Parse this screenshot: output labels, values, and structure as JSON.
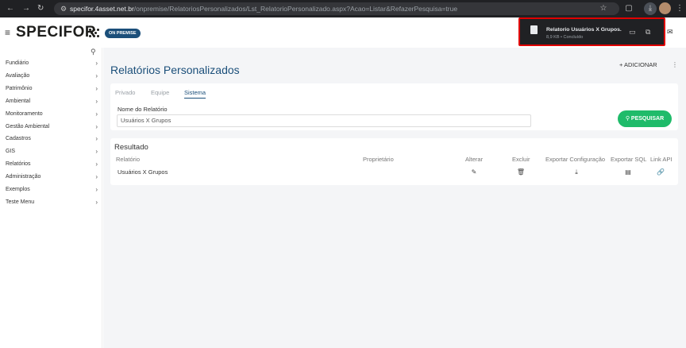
{
  "browser": {
    "url_host": "specifor.4asset.net.br",
    "url_path": "/onpremise/RelatoriosPersonalizados/Lst_RelatorioPersonalizado.aspx?Acao=Listar&RefazerPesquisa=true",
    "icons": [
      "back-arrow",
      "forward-arrow",
      "reload",
      "site-settings",
      "bookmark-star",
      "extensions",
      "downloads",
      "profile-avatar",
      "menu-kebab"
    ]
  },
  "download": {
    "file_name": "Relatorio Usuários X Grupos.",
    "status": "8,9 KB • Concluído"
  },
  "header": {
    "logo": "SPECIFOR",
    "badge": "ON PREMISE"
  },
  "sidebar": {
    "items": [
      {
        "label": "Fundiário"
      },
      {
        "label": "Avaliação"
      },
      {
        "label": "Patrimônio"
      },
      {
        "label": "Ambiental"
      },
      {
        "label": "Monitoramento"
      },
      {
        "label": "Gestão Ambiental"
      },
      {
        "label": "Cadastros"
      },
      {
        "label": "GIS"
      },
      {
        "label": "Relatórios"
      },
      {
        "label": "Administração"
      },
      {
        "label": "Exemplos"
      },
      {
        "label": "Teste Menu"
      }
    ]
  },
  "page": {
    "title": "Relatórios Personalizados",
    "add_label": "+ ADICIONAR"
  },
  "filter": {
    "tabs": [
      {
        "label": "Privado"
      },
      {
        "label": "Equipe"
      },
      {
        "label": "Sistema"
      }
    ],
    "active_tab": "Sistema",
    "field_label": "Nome do Relatório",
    "field_value": "Usuários X Grupos",
    "search_label": "PESQUISAR"
  },
  "results": {
    "title": "Resultado",
    "columns": {
      "relatorio": "Relatório",
      "proprietario": "Proprietário",
      "alterar": "Alterar",
      "excluir": "Excluir",
      "exportar_config": "Exportar Configuração",
      "exportar_sql": "Exportar SQL",
      "link_api": "Link API"
    },
    "rows": [
      {
        "relatorio": "Usuários X Grupos",
        "proprietario": ""
      }
    ]
  },
  "colors": {
    "primary": "#1b4f7a",
    "success": "#1fbb6a",
    "highlight_border": "#e00000",
    "chrome_bg": "#202124"
  }
}
